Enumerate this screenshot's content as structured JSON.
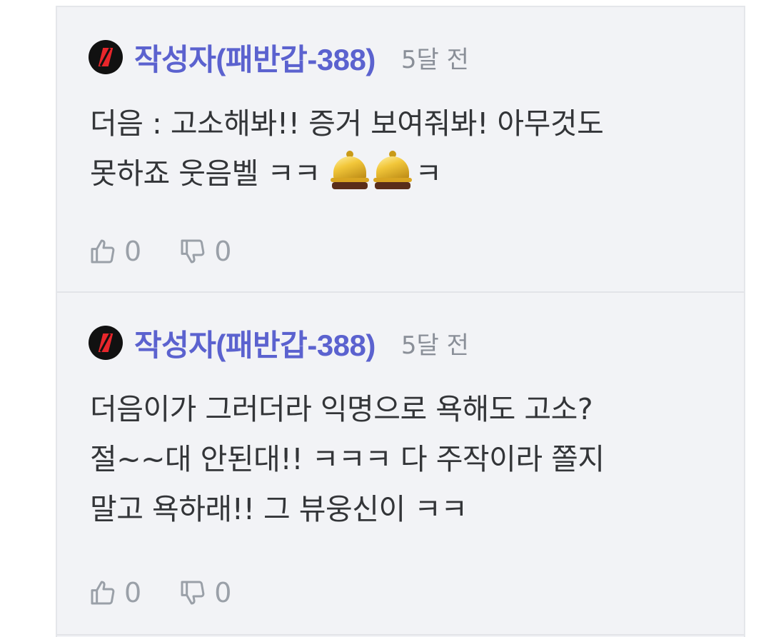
{
  "comments": [
    {
      "author": "작성자(패반갑-388)",
      "time": "5달 전",
      "body_lines": [
        "더음 : 고소해봐!! 증거 보여줘봐! 아무것도",
        "못하죠 웃음벨 ㅋㅋ"
      ],
      "body_tail": "ㅋ",
      "likes": "0",
      "dislikes": "0"
    },
    {
      "author": "작성자(패반갑-388)",
      "time": "5달 전",
      "body_lines": [
        "더음이가 그러더라 익명으로 욕해도 고소?",
        "절~~대 안된대!! ㅋㅋㅋ 다 주작이라 쫄지",
        "말고 욕하래!! 그 뷰웅신이 ㅋㅋ"
      ],
      "likes": "0",
      "dislikes": "0"
    }
  ],
  "icons": {
    "avatar": "avatar-icon",
    "like": "thumbs-up-icon",
    "dislike": "thumbs-down-icon",
    "emoji": "bellhop-bell-icon"
  },
  "colors": {
    "author": "#5b62cf",
    "panel_bg": "#f2f3f6",
    "avatar_accent": "#e8262b"
  }
}
